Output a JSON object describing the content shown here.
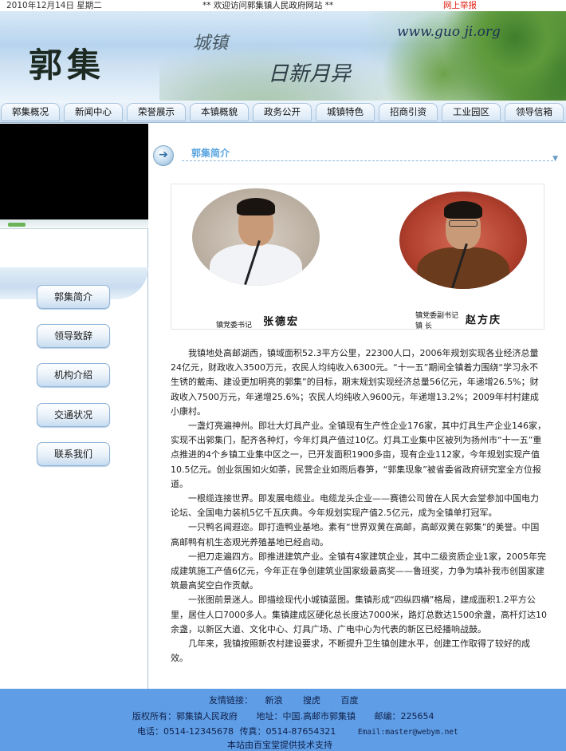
{
  "topbar": {
    "date": "2010年12月14日 星期二",
    "welcome": "** 欢迎访问郭集镇人民政府网站 **",
    "report": "网上举报"
  },
  "banner": {
    "logo": "郭集",
    "slogan1": "城镇",
    "slogan2": "日新月异",
    "url": "www.guo ji.org"
  },
  "nav": {
    "items": [
      "郭集概况",
      "新闻中心",
      "荣誉展示",
      "本镇概貌",
      "政务公开",
      "城镇特色",
      "招商引资",
      "工业园区",
      "领导信箱"
    ]
  },
  "sidebar": {
    "buttons": [
      "郭集简介",
      "领导致辞",
      "机构介绍",
      "交通状况",
      "联系我们"
    ]
  },
  "section": {
    "title": "郭集简介"
  },
  "photos": {
    "left": {
      "role": "镇党委书记",
      "name": "张德宏"
    },
    "right": {
      "role_line1": "镇党委副书记",
      "role_line2": "镇 长",
      "name": "赵方庆"
    }
  },
  "article": {
    "paragraphs": [
      "我镇地处高邮湖西，镇域面积52.3平方公里，22300人口，2006年规划实现各业经济总量24亿元，财政收入3500万元，农民人均纯收入6300元。“十一五”期间全镇着力围绕“学习永不生锈的戴南、建设更加明亮的郭集”的目标，期末规划实现经济总量56亿元，年递增26.5%；财政收入7500万元，年递增25.6%；农民人均纯收入9600元，年递增13.2%；2009年村村建成小康村。",
      "一盏灯亮遍神州。即壮大灯具产业。全镇现有生产性企业176家，其中灯具生产企业146家，实现不出郭集门，配齐各种灯，今年灯具产值过10亿。灯具工业集中区被列为扬州市“十一五”重点推进的4个乡镇工业集中区之一，已开发面积1900多亩，现有企业112家，今年规划实现产值10.5亿元。创业氛围如火如荼，民营企业如雨后春笋，“郭集现象”被省委省政府研究室全方位报道。",
      "一根缆连接世界。即发展电缆业。电缆龙头企业——赛德公司曾在人民大会堂参加中国电力论坛、全国电力装机5亿千瓦庆典。今年规划实现产值2.5亿元，成为全镇单打冠军。",
      "一只鸭名闻遐迩。即打造鸭业基地。素有“世界双黄在高邮，高邮双黄在郭集”的美誉。中国高邮鸭有机生态观光养殖基地已经启动。",
      "一把刀走遍四方。即推进建筑产业。全镇有4家建筑企业，其中二级资质企业1家，2005年完成建筑施工产值6亿元，今年正在争创建筑业国家级最高奖——鲁班奖，力争为填补我市创国家建筑最高奖空白作贡献。",
      "一张图前景迷人。即描绘现代小城镇蓝图。集镇形成“四纵四横”格局，建成面积1.2平方公里，居住人口7000多人。集镇建成区硬化总长度达7000米，路灯总数达1500余盏，高杆灯达10余盏，以新区大道、文化中心、灯具广场、广电中心为代表的新区已经播响战鼓。",
      "几年来，我镇按照新农村建设要求，不断提升卫生镇创建水平，创建工作取得了较好的成效。"
    ]
  },
  "footer": {
    "links_label": "友情链接：",
    "links": [
      "新浪",
      "搜虎",
      "百度"
    ],
    "copyright": "版权所有：郭集镇人民政府",
    "address": "地址：中国.高邮市郭集镇",
    "postcode": "邮编：225654",
    "phone": "电话：0514-12345678",
    "fax": "传真：0514-87654321",
    "email": "Email:master@webym.net",
    "support": "本站由百宝堂提供技术支持"
  },
  "colors": {
    "footer_bg": "#5f9ee6",
    "section_title": "#5aa5e0",
    "report_link": "#e21d12"
  }
}
